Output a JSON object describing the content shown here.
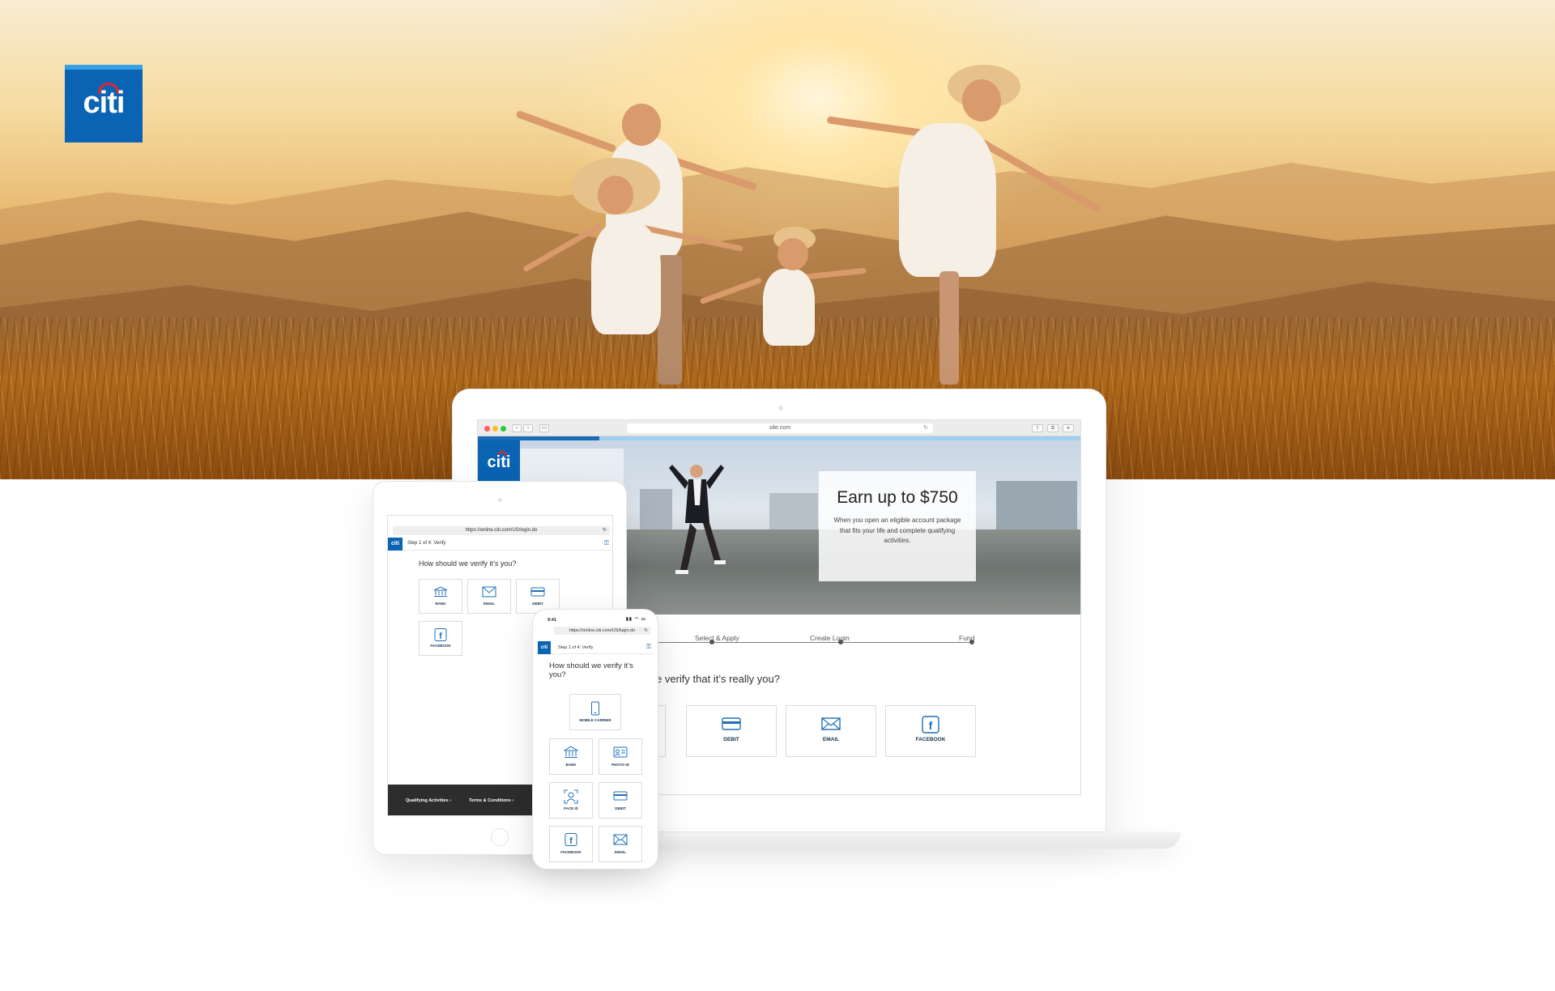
{
  "brand": {
    "name": "citi",
    "colors": {
      "blue": "#0a63b3",
      "red": "#e3262b",
      "light_blue": "#9fd0ef"
    }
  },
  "desktop": {
    "url": "site.com",
    "promo": {
      "headline": "Earn up to $750",
      "body": "When you open an eligible account package that fits your life and complete qualifying activities."
    },
    "steps": [
      "Select & Apply",
      "Create Login",
      "Fund"
    ],
    "question": "e verify that it’s really you?",
    "options": [
      {
        "label": "DEBIT",
        "icon": "credit-card-icon"
      },
      {
        "label": "EMAIL",
        "icon": "envelope-icon"
      },
      {
        "label": "FACEBOOK",
        "icon": "facebook-icon"
      }
    ]
  },
  "tablet": {
    "url": "https://online.citi.com/US/login.do",
    "step": "Step 1 of 4: Verify",
    "question": "How should we verify it’s you?",
    "options": [
      {
        "label": "BANK",
        "icon": "bank-icon"
      },
      {
        "label": "EMAIL",
        "icon": "envelope-icon"
      },
      {
        "label": "DEBIT",
        "icon": "credit-card-icon"
      },
      {
        "label": "FACEBOOK",
        "icon": "facebook-icon"
      }
    ],
    "footer": {
      "qualifying": "Qualifying Activities ›",
      "terms": "Terms & Conditions ›"
    }
  },
  "phone": {
    "time": "9:41",
    "url": "https://online.citi.com/US/login.do",
    "step": "Step 1 of 4: Verify",
    "question": "How should we verify it’s you?",
    "options": [
      {
        "label": "MOBILE CARRIER",
        "icon": "mobile-phone-icon"
      },
      {
        "label": "BANK",
        "icon": "bank-icon"
      },
      {
        "label": "PHOTO ID",
        "icon": "id-card-icon"
      },
      {
        "label": "FACE ID",
        "icon": "face-id-icon"
      },
      {
        "label": "DEBIT",
        "icon": "credit-card-icon"
      },
      {
        "label": "FACEBOOK",
        "icon": "facebook-icon"
      },
      {
        "label": "EMAIL",
        "icon": "envelope-icon"
      }
    ]
  }
}
